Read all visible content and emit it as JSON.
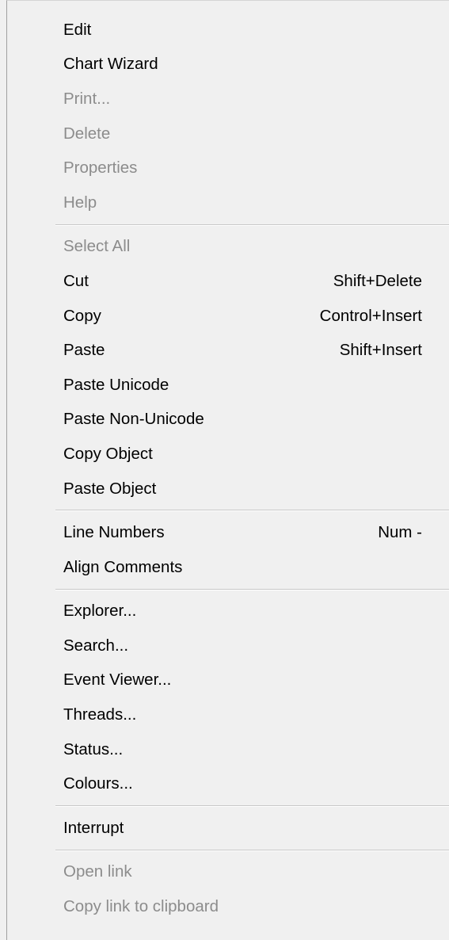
{
  "menu": {
    "edit": {
      "label": "Edit",
      "shortcut": ""
    },
    "chart_wizard": {
      "label": "Chart Wizard",
      "shortcut": ""
    },
    "print": {
      "label": "Print...",
      "shortcut": ""
    },
    "delete": {
      "label": "Delete",
      "shortcut": ""
    },
    "properties": {
      "label": "Properties",
      "shortcut": ""
    },
    "help": {
      "label": "Help",
      "shortcut": ""
    },
    "select_all": {
      "label": "Select All",
      "shortcut": ""
    },
    "cut": {
      "label": "Cut",
      "shortcut": "Shift+Delete"
    },
    "copy": {
      "label": "Copy",
      "shortcut": "Control+Insert"
    },
    "paste": {
      "label": "Paste",
      "shortcut": "Shift+Insert"
    },
    "paste_unicode": {
      "label": "Paste Unicode",
      "shortcut": ""
    },
    "paste_non_unicode": {
      "label": "Paste Non-Unicode",
      "shortcut": ""
    },
    "copy_object": {
      "label": "Copy Object",
      "shortcut": ""
    },
    "paste_object": {
      "label": "Paste Object",
      "shortcut": ""
    },
    "line_numbers": {
      "label": "Line Numbers",
      "shortcut": "Num -"
    },
    "align_comments": {
      "label": "Align Comments",
      "shortcut": ""
    },
    "explorer": {
      "label": "Explorer...",
      "shortcut": ""
    },
    "search": {
      "label": "Search...",
      "shortcut": ""
    },
    "event_viewer": {
      "label": "Event Viewer...",
      "shortcut": ""
    },
    "threads": {
      "label": "Threads...",
      "shortcut": ""
    },
    "status": {
      "label": "Status...",
      "shortcut": ""
    },
    "colours": {
      "label": "Colours...",
      "shortcut": ""
    },
    "interrupt": {
      "label": "Interrupt",
      "shortcut": ""
    },
    "open_link": {
      "label": "Open link",
      "shortcut": ""
    },
    "copy_link": {
      "label": "Copy link to clipboard",
      "shortcut": ""
    }
  },
  "colors": {
    "background": "#f0f0f0",
    "enabled_text": "#000000",
    "disabled_text": "#8c8c8c",
    "separator": "#c8c8c8"
  }
}
